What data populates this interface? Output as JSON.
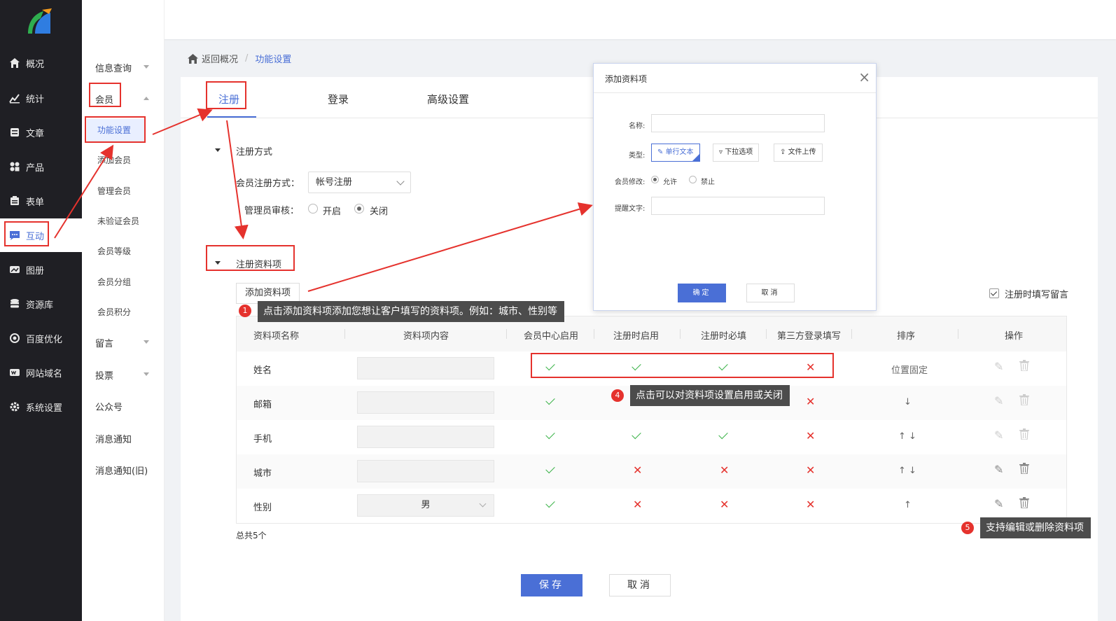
{
  "nav": {
    "items": [
      {
        "label": "概况",
        "icon": "home-icon"
      },
      {
        "label": "统计",
        "icon": "chart-icon"
      },
      {
        "label": "文章",
        "icon": "article-icon"
      },
      {
        "label": "产品",
        "icon": "grid-icon"
      },
      {
        "label": "表单",
        "icon": "form-icon"
      },
      {
        "label": "互动",
        "icon": "chat-icon"
      },
      {
        "label": "图册",
        "icon": "album-icon"
      },
      {
        "label": "资源库",
        "icon": "database-icon"
      },
      {
        "label": "百度优化",
        "icon": "target-icon"
      },
      {
        "label": "网站域名",
        "icon": "domain-icon"
      },
      {
        "label": "系统设置",
        "icon": "gear-icon"
      }
    ],
    "active_index": 5
  },
  "subnav": {
    "items": [
      {
        "label": "信息查询",
        "level": 0,
        "arrow": "down"
      },
      {
        "label": "会员",
        "level": 0,
        "arrow": "up"
      },
      {
        "label": "功能设置",
        "level": 1,
        "active": true
      },
      {
        "label": "添加会员",
        "level": 1
      },
      {
        "label": "管理会员",
        "level": 1
      },
      {
        "label": "未验证会员",
        "level": 1
      },
      {
        "label": "会员等级",
        "level": 1
      },
      {
        "label": "会员分组",
        "level": 1
      },
      {
        "label": "会员积分",
        "level": 1
      },
      {
        "label": "留言",
        "level": 0,
        "arrow": "down"
      },
      {
        "label": "投票",
        "level": 0,
        "arrow": "down"
      },
      {
        "label": "公众号",
        "level": 0
      },
      {
        "label": "消息通知",
        "level": 0
      },
      {
        "label": "消息通知(旧)",
        "level": 0
      }
    ]
  },
  "breadcrumb": {
    "back": "返回概况",
    "separator": "/",
    "current": "功能设置"
  },
  "tabs": [
    "注册",
    "登录",
    "高级设置"
  ],
  "reg_method": {
    "section_title": "注册方式",
    "method_label": "会员注册方式：",
    "method_value": "帐号注册",
    "review_label": "管理员审核：",
    "review_on": "开启",
    "review_off": "关闭",
    "review_selected": "关闭"
  },
  "reg_fields": {
    "section_title": "注册资料项",
    "add_button": "添加资料项",
    "remark_label": "注册时填写留言",
    "remark_checked": true,
    "columns": [
      "资料项名称",
      "资料项内容",
      "会员中心启用",
      "注册时启用",
      "注册时必填",
      "第三方登录填写",
      "排序",
      "操作"
    ],
    "rows": [
      {
        "name": "姓名",
        "content": "",
        "center": true,
        "reg": true,
        "required": true,
        "third": false,
        "sort": "位置固定",
        "editable": false
      },
      {
        "name": "邮箱",
        "content": "",
        "center": true,
        "reg": true,
        "required": true,
        "third": false,
        "sort": "↓",
        "editable": false
      },
      {
        "name": "手机",
        "content": "",
        "center": true,
        "reg": true,
        "required": true,
        "third": false,
        "sort": "↑ ↓",
        "editable": false
      },
      {
        "name": "城市",
        "content": "",
        "center": true,
        "reg": false,
        "required": false,
        "third": false,
        "sort": "↑ ↓",
        "editable": true
      },
      {
        "name": "性别",
        "content": "男",
        "center": true,
        "reg": false,
        "required": false,
        "third": false,
        "sort": "↑",
        "editable": true
      }
    ],
    "total": "总共5个"
  },
  "buttons": {
    "save": "保存",
    "cancel": "取消"
  },
  "dialog": {
    "title": "添加资料项",
    "close": "×",
    "name_label": "名称:",
    "type_label": "类型:",
    "types": [
      "单行文本",
      "下拉选项",
      "文件上传"
    ],
    "modify_label": "会员修改:",
    "modify_allow": "允许",
    "modify_deny": "禁止",
    "hint_label": "提醒文字:",
    "ok": "确定",
    "cancel": "取消"
  },
  "tips": [
    {
      "num": "1",
      "text": "点击添加资料项添加您想让客户填写的资料项。例如：城市、性别等"
    },
    {
      "num": "4",
      "text": "点击可以对资料项设置启用或关闭"
    },
    {
      "num": "5",
      "text": "支持编辑或删除资料项"
    }
  ],
  "colors": {
    "accent": "#4a6fd6",
    "nav_bg": "#1f1f24",
    "highlight": "#e5322d",
    "check": "#3cb34a"
  }
}
